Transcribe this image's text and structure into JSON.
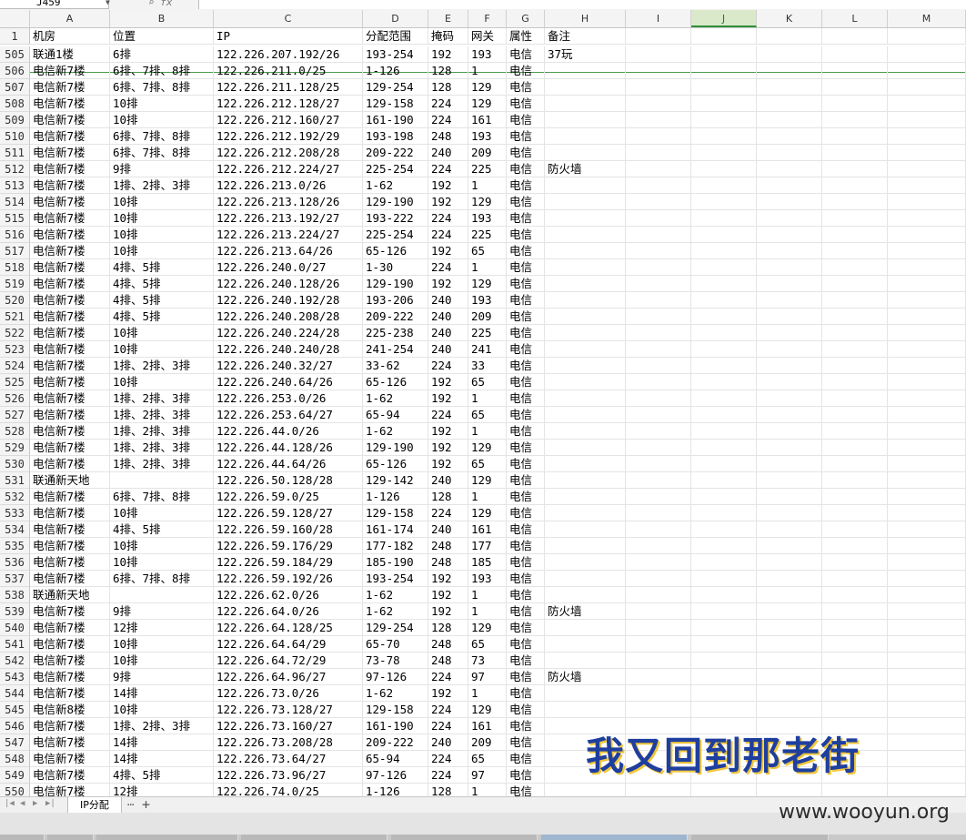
{
  "formula_bar": {
    "namebox": "J459",
    "fx_label": "fx"
  },
  "columns": [
    "A",
    "B",
    "C",
    "D",
    "E",
    "F",
    "G",
    "H",
    "I",
    "J",
    "K",
    "L",
    "M"
  ],
  "selected_column": "J",
  "header_row": {
    "row_num": "1",
    "cells": [
      "机房",
      "位置",
      "IP",
      "分配范围",
      "掩码",
      "网关",
      "属性",
      "备注"
    ]
  },
  "rows": [
    [
      "505",
      "联通1楼",
      "6排",
      "122.226.207.192/26",
      "193-254",
      "192",
      "193",
      "电信",
      "37玩"
    ],
    [
      "506",
      "电信新7楼",
      "6排、7排、8排",
      "122.226.211.0/25",
      "1-126",
      "128",
      "1",
      "电信",
      ""
    ],
    [
      "507",
      "电信新7楼",
      "6排、7排、8排",
      "122.226.211.128/25",
      "129-254",
      "128",
      "129",
      "电信",
      ""
    ],
    [
      "508",
      "电信新7楼",
      "10排",
      "122.226.212.128/27",
      "129-158",
      "224",
      "129",
      "电信",
      ""
    ],
    [
      "509",
      "电信新7楼",
      "10排",
      "122.226.212.160/27",
      "161-190",
      "224",
      "161",
      "电信",
      ""
    ],
    [
      "510",
      "电信新7楼",
      "6排、7排、8排",
      "122.226.212.192/29",
      "193-198",
      "248",
      "193",
      "电信",
      ""
    ],
    [
      "511",
      "电信新7楼",
      "6排、7排、8排",
      "122.226.212.208/28",
      "209-222",
      "240",
      "209",
      "电信",
      ""
    ],
    [
      "512",
      "电信新7楼",
      "9排",
      "122.226.212.224/27",
      "225-254",
      "224",
      "225",
      "电信",
      "防火墙"
    ],
    [
      "513",
      "电信新7楼",
      "1排、2排、3排",
      "122.226.213.0/26",
      "1-62",
      "192",
      "1",
      "电信",
      ""
    ],
    [
      "514",
      "电信新7楼",
      "10排",
      "122.226.213.128/26",
      "129-190",
      "192",
      "129",
      "电信",
      ""
    ],
    [
      "515",
      "电信新7楼",
      "10排",
      "122.226.213.192/27",
      "193-222",
      "224",
      "193",
      "电信",
      ""
    ],
    [
      "516",
      "电信新7楼",
      "10排",
      "122.226.213.224/27",
      "225-254",
      "224",
      "225",
      "电信",
      ""
    ],
    [
      "517",
      "电信新7楼",
      "10排",
      "122.226.213.64/26",
      "65-126",
      "192",
      "65",
      "电信",
      ""
    ],
    [
      "518",
      "电信新7楼",
      "4排、5排",
      "122.226.240.0/27",
      "1-30",
      "224",
      "1",
      "电信",
      ""
    ],
    [
      "519",
      "电信新7楼",
      "4排、5排",
      "122.226.240.128/26",
      "129-190",
      "192",
      "129",
      "电信",
      ""
    ],
    [
      "520",
      "电信新7楼",
      "4排、5排",
      "122.226.240.192/28",
      "193-206",
      "240",
      "193",
      "电信",
      ""
    ],
    [
      "521",
      "电信新7楼",
      "4排、5排",
      "122.226.240.208/28",
      "209-222",
      "240",
      "209",
      "电信",
      ""
    ],
    [
      "522",
      "电信新7楼",
      "10排",
      "122.226.240.224/28",
      "225-238",
      "240",
      "225",
      "电信",
      ""
    ],
    [
      "523",
      "电信新7楼",
      "10排",
      "122.226.240.240/28",
      "241-254",
      "240",
      "241",
      "电信",
      ""
    ],
    [
      "524",
      "电信新7楼",
      "1排、2排、3排",
      "122.226.240.32/27",
      "33-62",
      "224",
      "33",
      "电信",
      ""
    ],
    [
      "525",
      "电信新7楼",
      "10排",
      "122.226.240.64/26",
      "65-126",
      "192",
      "65",
      "电信",
      ""
    ],
    [
      "526",
      "电信新7楼",
      "1排、2排、3排",
      "122.226.253.0/26",
      "1-62",
      "192",
      "1",
      "电信",
      ""
    ],
    [
      "527",
      "电信新7楼",
      "1排、2排、3排",
      "122.226.253.64/27",
      "65-94",
      "224",
      "65",
      "电信",
      ""
    ],
    [
      "528",
      "电信新7楼",
      "1排、2排、3排",
      "122.226.44.0/26",
      "1-62",
      "192",
      "1",
      "电信",
      ""
    ],
    [
      "529",
      "电信新7楼",
      "1排、2排、3排",
      "122.226.44.128/26",
      "129-190",
      "192",
      "129",
      "电信",
      ""
    ],
    [
      "530",
      "电信新7楼",
      "1排、2排、3排",
      "122.226.44.64/26",
      "65-126",
      "192",
      "65",
      "电信",
      ""
    ],
    [
      "531",
      "联通新天地",
      "",
      "122.226.50.128/28",
      "129-142",
      "240",
      "129",
      "电信",
      ""
    ],
    [
      "532",
      "电信新7楼",
      "6排、7排、8排",
      "122.226.59.0/25",
      "1-126",
      "128",
      "1",
      "电信",
      ""
    ],
    [
      "533",
      "电信新7楼",
      "10排",
      "122.226.59.128/27",
      "129-158",
      "224",
      "129",
      "电信",
      ""
    ],
    [
      "534",
      "电信新7楼",
      "4排、5排",
      "122.226.59.160/28",
      "161-174",
      "240",
      "161",
      "电信",
      ""
    ],
    [
      "535",
      "电信新7楼",
      "10排",
      "122.226.59.176/29",
      "177-182",
      "248",
      "177",
      "电信",
      ""
    ],
    [
      "536",
      "电信新7楼",
      "10排",
      "122.226.59.184/29",
      "185-190",
      "248",
      "185",
      "电信",
      ""
    ],
    [
      "537",
      "电信新7楼",
      "6排、7排、8排",
      "122.226.59.192/26",
      "193-254",
      "192",
      "193",
      "电信",
      ""
    ],
    [
      "538",
      "联通新天地",
      "",
      "122.226.62.0/26",
      "1-62",
      "192",
      "1",
      "电信",
      ""
    ],
    [
      "539",
      "电信新7楼",
      "9排",
      "122.226.64.0/26",
      "1-62",
      "192",
      "1",
      "电信",
      "防火墙"
    ],
    [
      "540",
      "电信新7楼",
      "12排",
      "122.226.64.128/25",
      "129-254",
      "128",
      "129",
      "电信",
      ""
    ],
    [
      "541",
      "电信新7楼",
      "10排",
      "122.226.64.64/29",
      "65-70",
      "248",
      "65",
      "电信",
      ""
    ],
    [
      "542",
      "电信新7楼",
      "10排",
      "122.226.64.72/29",
      "73-78",
      "248",
      "73",
      "电信",
      ""
    ],
    [
      "543",
      "电信新7楼",
      "9排",
      "122.226.64.96/27",
      "97-126",
      "224",
      "97",
      "电信",
      "防火墙"
    ],
    [
      "544",
      "电信新7楼",
      "14排",
      "122.226.73.0/26",
      "1-62",
      "192",
      "1",
      "电信",
      ""
    ],
    [
      "545",
      "电信新8楼",
      "10排",
      "122.226.73.128/27",
      "129-158",
      "224",
      "129",
      "电信",
      ""
    ],
    [
      "546",
      "电信新7楼",
      "1排、2排、3排",
      "122.226.73.160/27",
      "161-190",
      "224",
      "161",
      "电信",
      ""
    ],
    [
      "547",
      "电信新7楼",
      "14排",
      "122.226.73.208/28",
      "209-222",
      "240",
      "209",
      "电信",
      ""
    ],
    [
      "548",
      "电信新7楼",
      "14排",
      "122.226.73.64/27",
      "65-94",
      "224",
      "65",
      "电信",
      ""
    ],
    [
      "549",
      "电信新7楼",
      "4排、5排",
      "122.226.73.96/27",
      "97-126",
      "224",
      "97",
      "电信",
      ""
    ],
    [
      "550",
      "电信新7楼",
      "12排",
      "122.226.74.0/25",
      "1-126",
      "128",
      "1",
      "电信",
      ""
    ]
  ],
  "sheet_tab": {
    "label": "IP分配",
    "more": "⋯",
    "add": "+"
  },
  "watermark": {
    "title": "我又回到那老街",
    "url": "www.wooyun.org"
  },
  "colors": {
    "selected_col_bg": "#d9e9c9",
    "freeze_line": "#4a9a4a",
    "watermark_blue": "#1f3f9e",
    "watermark_gold": "#f0c63a"
  }
}
